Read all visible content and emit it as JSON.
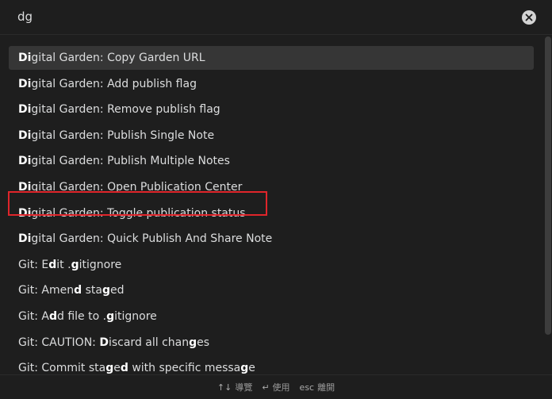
{
  "search": {
    "value": "dg"
  },
  "results": [
    {
      "parts": [
        {
          "t": "Di",
          "b": true
        },
        {
          "t": "gital Garden: Copy Garden URL",
          "b": false
        }
      ],
      "selected": true
    },
    {
      "parts": [
        {
          "t": "Di",
          "b": true
        },
        {
          "t": "gital Garden: Add publish flag",
          "b": false
        }
      ],
      "selected": false
    },
    {
      "parts": [
        {
          "t": "Di",
          "b": true
        },
        {
          "t": "gital Garden: Remove publish flag",
          "b": false
        }
      ],
      "selected": false
    },
    {
      "parts": [
        {
          "t": "Di",
          "b": true
        },
        {
          "t": "gital Garden: Publish Single Note",
          "b": false
        }
      ],
      "selected": false
    },
    {
      "parts": [
        {
          "t": "Di",
          "b": true
        },
        {
          "t": "gital Garden: Publish Multiple Notes",
          "b": false
        }
      ],
      "selected": false
    },
    {
      "parts": [
        {
          "t": "Di",
          "b": true
        },
        {
          "t": "gital Garden: Open Publication Center",
          "b": false
        }
      ],
      "selected": false
    },
    {
      "parts": [
        {
          "t": "Di",
          "b": true
        },
        {
          "t": "gital Garden: Toggle publication status",
          "b": false
        }
      ],
      "selected": false
    },
    {
      "parts": [
        {
          "t": "Di",
          "b": true
        },
        {
          "t": "gital Garden: Quick Publish And Share Note",
          "b": false
        }
      ],
      "selected": false,
      "highlighted": true
    },
    {
      "parts": [
        {
          "t": "Git: E",
          "b": false
        },
        {
          "t": "d",
          "b": true
        },
        {
          "t": "it .",
          "b": false
        },
        {
          "t": "g",
          "b": true
        },
        {
          "t": "itignore",
          "b": false
        }
      ],
      "selected": false
    },
    {
      "parts": [
        {
          "t": "Git: Amen",
          "b": false
        },
        {
          "t": "d",
          "b": true
        },
        {
          "t": " sta",
          "b": false
        },
        {
          "t": "g",
          "b": true
        },
        {
          "t": "ed",
          "b": false
        }
      ],
      "selected": false
    },
    {
      "parts": [
        {
          "t": "Git: A",
          "b": false
        },
        {
          "t": "d",
          "b": true
        },
        {
          "t": "d file to .",
          "b": false
        },
        {
          "t": "g",
          "b": true
        },
        {
          "t": "itignore",
          "b": false
        }
      ],
      "selected": false
    },
    {
      "parts": [
        {
          "t": "Git: CAUTION: ",
          "b": false
        },
        {
          "t": "D",
          "b": true
        },
        {
          "t": "iscard all chan",
          "b": false
        },
        {
          "t": "g",
          "b": true
        },
        {
          "t": "es",
          "b": false
        }
      ],
      "selected": false
    },
    {
      "parts": [
        {
          "t": "Git: Commit sta",
          "b": false
        },
        {
          "t": "g",
          "b": true
        },
        {
          "t": "e",
          "b": false
        },
        {
          "t": "d",
          "b": true
        },
        {
          "t": " with specific messa",
          "b": false
        },
        {
          "t": "g",
          "b": true
        },
        {
          "t": "e",
          "b": false
        }
      ],
      "selected": false
    }
  ],
  "footer": {
    "navigate_key": "↑↓",
    "navigate_label": "導覽",
    "use_key": "↵",
    "use_label": "使用",
    "dismiss_key": "esc",
    "dismiss_label": "離開"
  },
  "colors": {
    "background": "#1e1e1e",
    "selected_row": "#363636",
    "highlight_border": "#e0252b",
    "text": "#dcddde"
  },
  "icons": {
    "clear": "close-circle-icon"
  }
}
